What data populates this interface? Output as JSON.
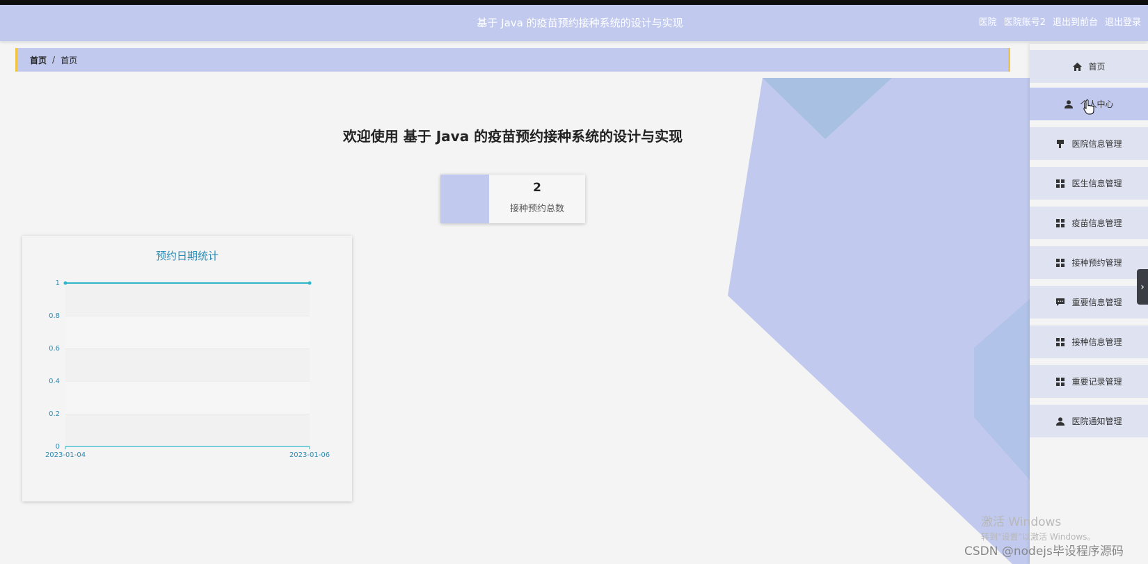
{
  "header": {
    "title": "基于 Java 的疫苗预约接种系统的设计与实现",
    "role": "医院",
    "account": "医院账号2",
    "front_link": "退出到前台",
    "logout_link": "退出登录"
  },
  "breadcrumb": [
    "首页",
    "首页"
  ],
  "welcome": "欢迎使用 基于 Java 的疫苗预约接种系统的设计与实现",
  "stat": {
    "value": "2",
    "label": "接种预约总数"
  },
  "chart_data": {
    "type": "line",
    "title": "预约日期统计",
    "x": [
      "2023-01-04",
      "2023-01-06"
    ],
    "values": [
      1,
      1
    ],
    "yticks": [
      "0",
      "0.2",
      "0.4",
      "0.6",
      "0.8",
      "1"
    ],
    "ylim": [
      0,
      1
    ],
    "grid": true,
    "color": "#2eb6c8"
  },
  "sidebar": {
    "items": [
      {
        "label": "首页",
        "icon": "home-icon"
      },
      {
        "label": "个人中心",
        "icon": "user-icon"
      },
      {
        "label": "医院信息管理",
        "icon": "flag-icon"
      },
      {
        "label": "医生信息管理",
        "icon": "grid-icon"
      },
      {
        "label": "疫苗信息管理",
        "icon": "grid-icon"
      },
      {
        "label": "接种预约管理",
        "icon": "grid-icon"
      },
      {
        "label": "重要信息管理",
        "icon": "message-icon"
      },
      {
        "label": "接种信息管理",
        "icon": "grid-icon"
      },
      {
        "label": "重要记录管理",
        "icon": "grid-icon"
      },
      {
        "label": "医院通知管理",
        "icon": "user-icon"
      }
    ]
  },
  "watermark": {
    "line1": "激活 Windows",
    "line2": "转到\"设置\"以激活 Windows。"
  },
  "credit": "CSDN @nodejs毕设程序源码",
  "colors": {
    "primary": "#c1caee",
    "accent": "#f0c449",
    "chart": "#2eb6c8"
  }
}
